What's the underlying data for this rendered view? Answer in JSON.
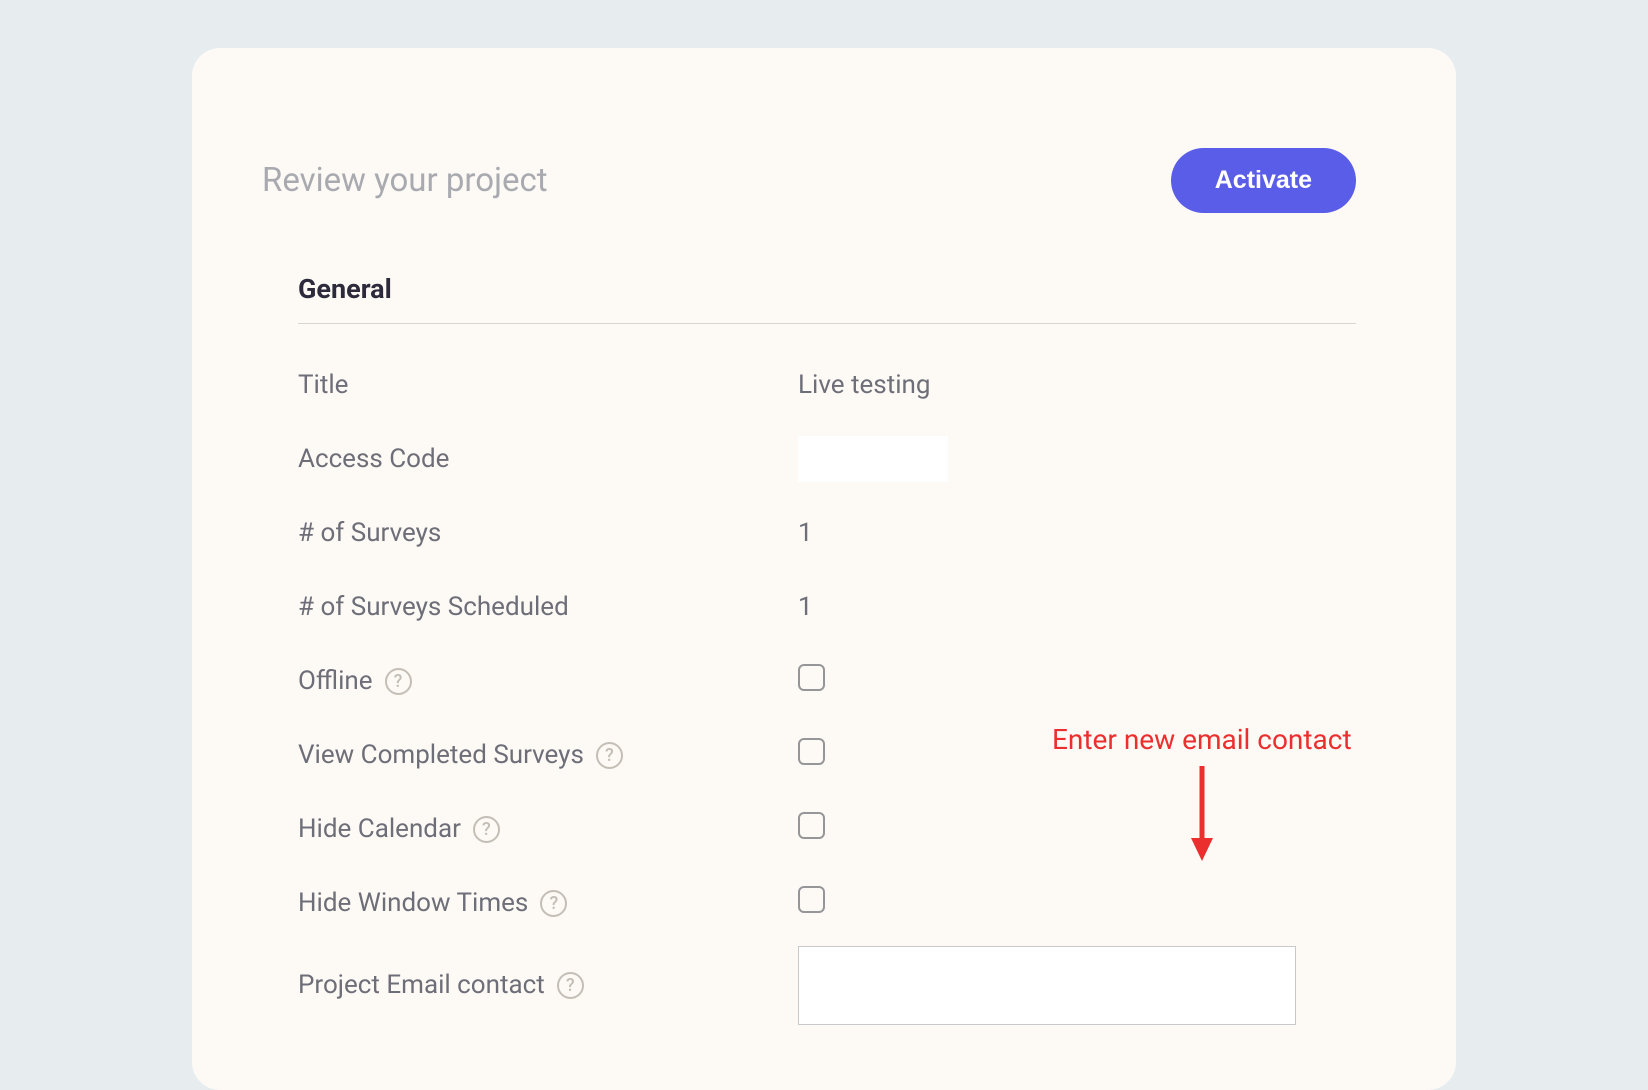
{
  "header": {
    "title": "Review your project",
    "activate_label": "Activate"
  },
  "section": {
    "title": "General",
    "rows": {
      "title_label": "Title",
      "title_value": "Live testing",
      "access_code_label": "Access Code",
      "access_code_value": "",
      "num_surveys_label": "# of Surveys",
      "num_surveys_value": "1",
      "num_scheduled_label": "# of Surveys Scheduled",
      "num_scheduled_value": "1",
      "offline_label": "Offline",
      "view_completed_label": "View Completed Surveys",
      "hide_calendar_label": "Hide Calendar",
      "hide_window_times_label": "Hide Window Times",
      "project_email_label": "Project Email contact"
    }
  },
  "annotation": {
    "text": "Enter new email contact"
  },
  "help_glyph": "?"
}
